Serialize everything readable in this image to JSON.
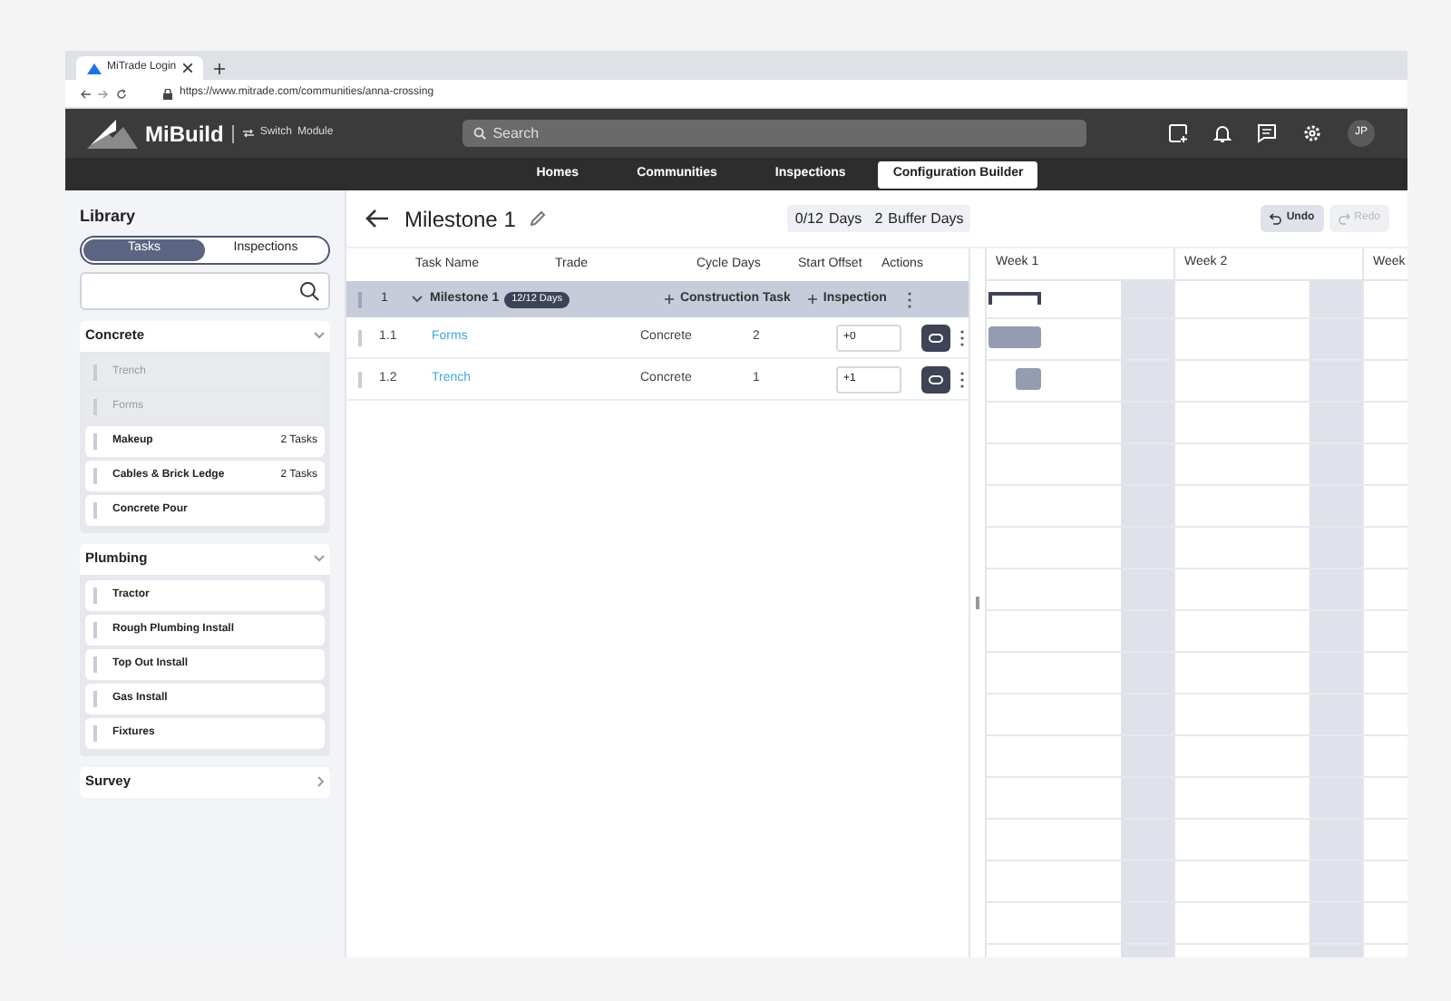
{
  "browser": {
    "tab_title": "MiTrade Login",
    "url": "https://www.mitrade.com/communities/anna-crossing"
  },
  "app": {
    "brand": "MiBuild",
    "switch_label": "Switch",
    "module_label": "Module",
    "search_placeholder": "Search",
    "avatar": "JP"
  },
  "nav": [
    {
      "label": "Homes",
      "selected": false
    },
    {
      "label": "Communities",
      "selected": false
    },
    {
      "label": "Inspections",
      "selected": false
    },
    {
      "label": "Configuration Builder",
      "selected": true
    }
  ],
  "library": {
    "title": "Library",
    "tabs": [
      {
        "label": "Tasks",
        "selected": true
      },
      {
        "label": "Inspections",
        "selected": false
      }
    ],
    "groups": [
      {
        "name": "Concrete",
        "expanded": true,
        "items": [
          {
            "label": "Trench",
            "disabled": true
          },
          {
            "label": "Forms",
            "disabled": true
          },
          {
            "label": "Makeup",
            "disabled": false,
            "count": "2 Tasks"
          },
          {
            "label": "Cables & Brick Ledge",
            "disabled": false,
            "count": "2 Tasks"
          },
          {
            "label": "Concrete Pour",
            "disabled": false
          }
        ]
      },
      {
        "name": "Plumbing",
        "expanded": true,
        "items": [
          {
            "label": "Tractor",
            "disabled": false
          },
          {
            "label": "Rough Plumbing Install",
            "disabled": false
          },
          {
            "label": "Top Out Install",
            "disabled": false
          },
          {
            "label": "Gas Install",
            "disabled": false
          },
          {
            "label": "Fixtures",
            "disabled": false
          }
        ]
      },
      {
        "name": "Survey",
        "expanded": false
      }
    ]
  },
  "milestone": {
    "title": "Milestone 1",
    "days": "0/12",
    "days_label": "Days",
    "buffer": "2",
    "buffer_label": "Buffer Days",
    "undo": {
      "label": "Undo",
      "disabled": false
    },
    "redo": {
      "label": "Redo",
      "disabled": true
    }
  },
  "table": {
    "columns": [
      "Task Name",
      "Trade",
      "Cycle Days",
      "Start Offset",
      "Actions"
    ],
    "group_row": {
      "number": "1",
      "name": "Milestone 1",
      "badge": "12/12 Days",
      "add_task": "Construction Task",
      "add_inspection": "Inspection",
      "expanded": true
    },
    "rows": [
      {
        "number": "1.1",
        "name": "Forms",
        "trade": "Concrete",
        "cycle_days": "2",
        "start_offset": "+0"
      },
      {
        "number": "1.2",
        "name": "Trench",
        "trade": "Concrete",
        "cycle_days": "1",
        "start_offset": "+1"
      }
    ]
  },
  "gantt": {
    "weeks": [
      "Week 1",
      "Week 2",
      "Week"
    ]
  }
}
